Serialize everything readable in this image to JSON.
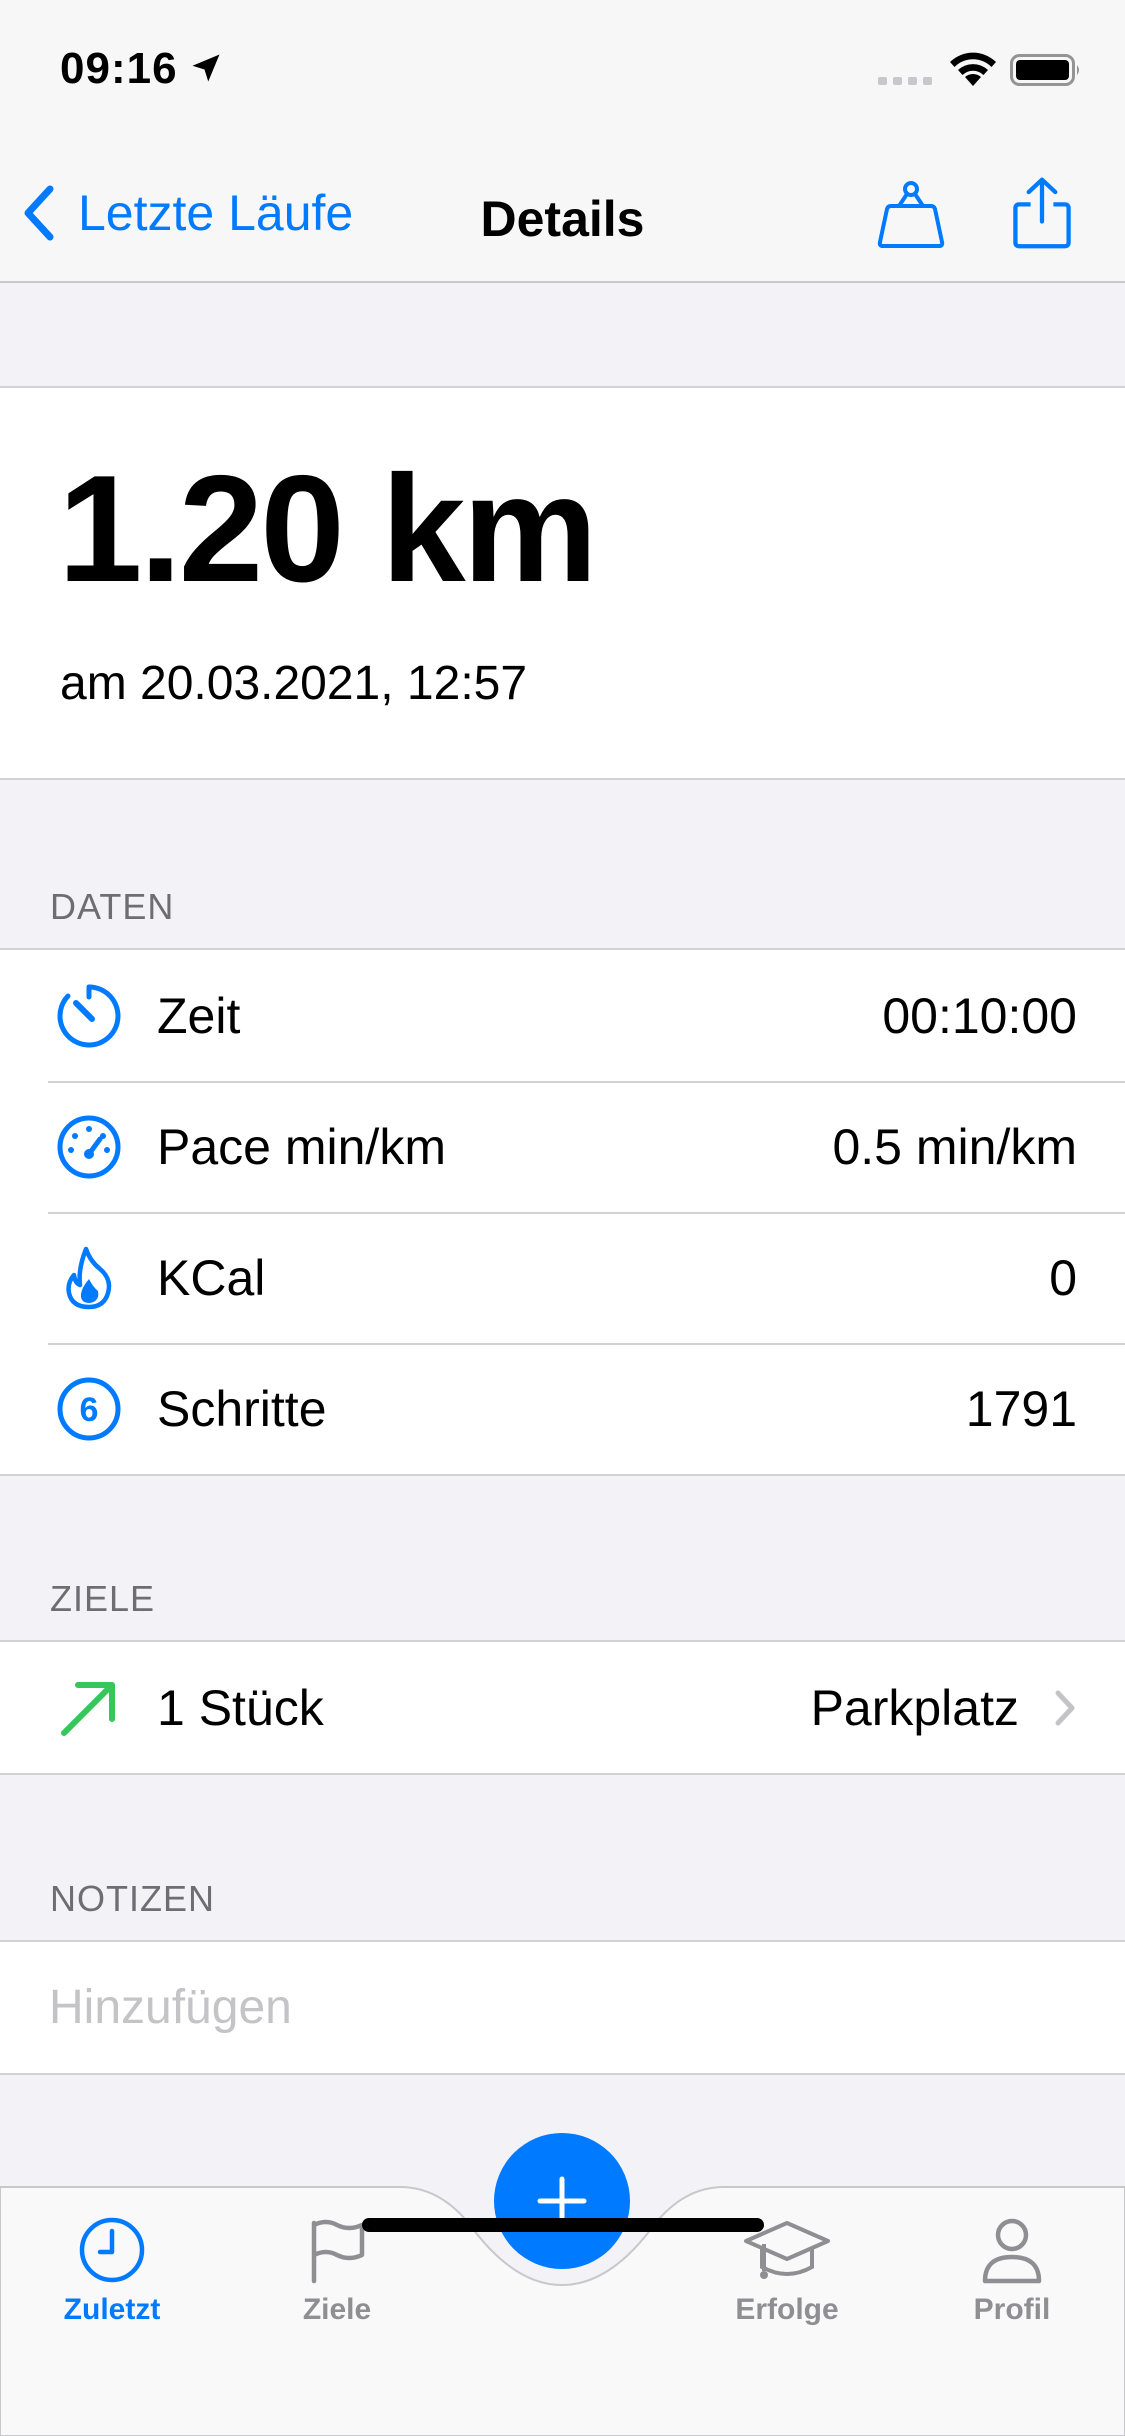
{
  "status_bar": {
    "time": "09:16"
  },
  "nav": {
    "back_label": "Letzte Läufe",
    "title": "Details"
  },
  "hero": {
    "distance": "1.20 km",
    "date": "am 20.03.2021, 12:57"
  },
  "sections": {
    "data_header": "DATEN",
    "goals_header": "ZIELE",
    "notes_header": "NOTIZEN"
  },
  "data_rows": [
    {
      "icon": "timer-icon",
      "label": "Zeit",
      "value": "00:10:00"
    },
    {
      "icon": "speedometer-icon",
      "label": "Pace min/km",
      "value": "0.5 min/km"
    },
    {
      "icon": "flame-icon",
      "label": "KCal",
      "value": "0"
    },
    {
      "icon": "number-6-circle-icon",
      "label": "Schritte",
      "value": "1791"
    }
  ],
  "goal_row": {
    "icon": "arrow-up-right-icon",
    "label": "1 Stück",
    "value": "Parkplatz"
  },
  "notes": {
    "placeholder": "Hinzufügen"
  },
  "tabs": [
    {
      "icon": "clock-icon",
      "label": "Zuletzt",
      "active": true
    },
    {
      "icon": "flag-icon",
      "label": "Ziele",
      "active": false
    },
    {
      "icon": "graduation-cap-icon",
      "label": "Erfolge",
      "active": false
    },
    {
      "icon": "person-icon",
      "label": "Profil",
      "active": false
    }
  ],
  "colors": {
    "accent": "#007aff",
    "green": "#34c759",
    "background": "#f2f2f7"
  }
}
